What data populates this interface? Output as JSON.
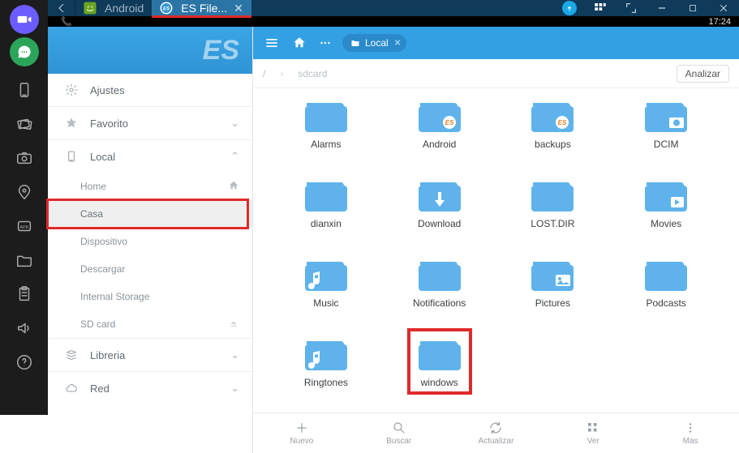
{
  "emulator": {
    "clock": "17:24"
  },
  "window": {
    "tabs": [
      {
        "label": "Android",
        "active": false
      },
      {
        "label": "ES File...",
        "active": true
      }
    ]
  },
  "sidebar": {
    "hero": "ES",
    "sections": {
      "ajustes": "Ajustes",
      "favorito": "Favorito",
      "local": "Local",
      "libreria": "Libreria",
      "red": "Red"
    },
    "local_items": {
      "home": "Home",
      "casa": "Casa",
      "dispositivo": "Dispositivo",
      "descargar": "Descargar",
      "internal": "Internal Storage",
      "sdcard": "SD card"
    }
  },
  "topstrip": {
    "chip_label": "Local"
  },
  "pathbar": {
    "root": "/",
    "segment": "sdcard",
    "analizar": "Analizar"
  },
  "folders": [
    {
      "name": "Alarms",
      "icon": "plain"
    },
    {
      "name": "Android",
      "icon": "es"
    },
    {
      "name": "backups",
      "icon": "es"
    },
    {
      "name": "DCIM",
      "icon": "camera"
    },
    {
      "name": "dianxin",
      "icon": "plain"
    },
    {
      "name": "Download",
      "icon": "download"
    },
    {
      "name": "LOST.DIR",
      "icon": "plain"
    },
    {
      "name": "Movies",
      "icon": "play"
    },
    {
      "name": "Music",
      "icon": "music"
    },
    {
      "name": "Notifications",
      "icon": "plain"
    },
    {
      "name": "Pictures",
      "icon": "image"
    },
    {
      "name": "Podcasts",
      "icon": "plain"
    },
    {
      "name": "Ringtones",
      "icon": "music"
    },
    {
      "name": "windows",
      "icon": "plain",
      "highlight": true
    }
  ],
  "bottombar": {
    "nuevo": "Nuevo",
    "buscar": "Buscar",
    "actualizar": "Actualizar",
    "ver": "Ver",
    "mas": "Mas"
  }
}
